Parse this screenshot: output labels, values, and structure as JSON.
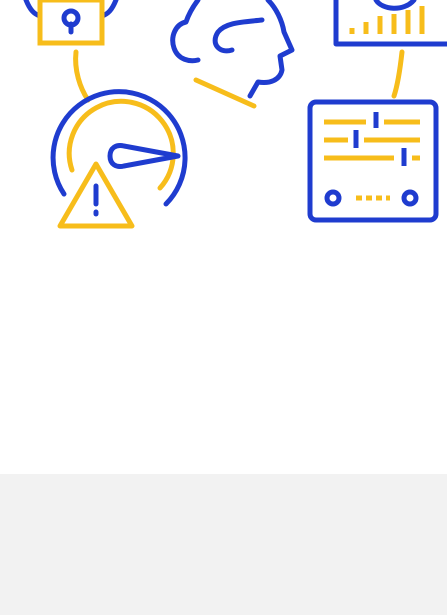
{
  "illustration": {
    "colors": {
      "primary_blue": "#1f3ccf",
      "accent_yellow": "#f7bd1b",
      "background": "#ffffff",
      "footer_band": "#f2f2f2"
    },
    "icons": [
      "padlock-icon",
      "user-head-icon",
      "bar-chart-icon",
      "gauge-warning-icon",
      "control-panel-icon"
    ]
  }
}
